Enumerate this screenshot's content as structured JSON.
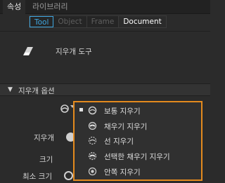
{
  "panel": {
    "tabs": [
      {
        "label": "속성",
        "active": true
      },
      {
        "label": "라이브러리",
        "active": false
      }
    ]
  },
  "subtabs": [
    {
      "label": "Tool",
      "state": "selected"
    },
    {
      "label": "Object",
      "state": "disabled"
    },
    {
      "label": "Frame",
      "state": "disabled"
    },
    {
      "label": "Document",
      "state": "current"
    }
  ],
  "tool": {
    "name": "지우개 도구",
    "icon": "eraser-icon"
  },
  "section": {
    "title": "지우개 옵션",
    "expanded": true
  },
  "fields": {
    "mode_label": "지우개",
    "size_label": "크기",
    "min_size_label": "최소 크기"
  },
  "eraser_modes": {
    "selected_index": 0,
    "items": [
      {
        "label": "보통 지우기",
        "icon": "normal-erase-icon"
      },
      {
        "label": "채우기 지우기",
        "icon": "erase-fills-icon"
      },
      {
        "label": "선 지우기",
        "icon": "erase-lines-icon"
      },
      {
        "label": "선택한 채우기 지우기",
        "icon": "erase-selected-fills-icon"
      },
      {
        "label": "안쪽 지우기",
        "icon": "erase-inside-icon"
      }
    ]
  },
  "colors": {
    "accent": "#3ea6e0",
    "highlight_border": "#e38a1e"
  }
}
